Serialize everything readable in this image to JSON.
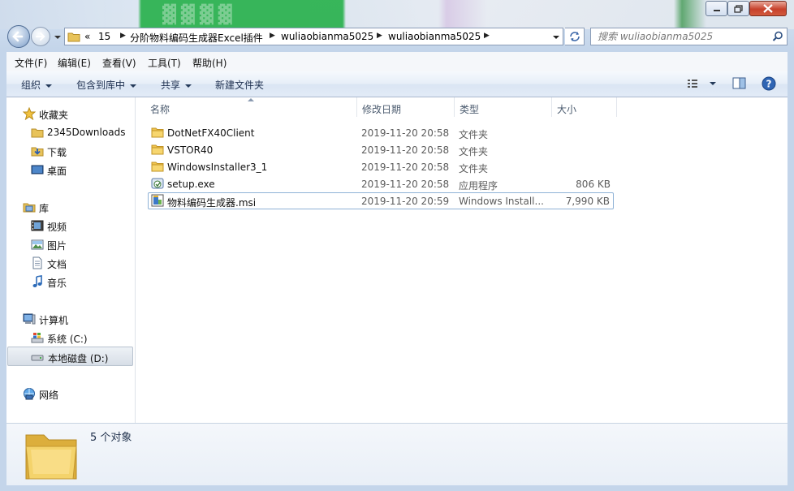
{
  "address_bar": {
    "overflow": "«",
    "crumbs": [
      "15",
      "分阶物料编码生成器Excel插件",
      "wuliaobianma5025",
      "wuliaobianma5025"
    ]
  },
  "search": {
    "placeholder": "搜索 wuliaobianma5025"
  },
  "menu": [
    "文件(F)",
    "编辑(E)",
    "查看(V)",
    "工具(T)",
    "帮助(H)"
  ],
  "commands": {
    "organize": "组织",
    "include_library": "包含到库中",
    "share": "共享",
    "new_folder": "新建文件夹"
  },
  "nav": {
    "favorites": {
      "label": "收藏夹",
      "items": [
        "2345Downloads",
        "下载",
        "桌面"
      ]
    },
    "library": {
      "label": "库",
      "items": [
        "视频",
        "图片",
        "文档",
        "音乐"
      ]
    },
    "computer": {
      "label": "计算机",
      "items": [
        "系统 (C:)",
        "本地磁盘 (D:)"
      ]
    },
    "network": {
      "label": "网络"
    }
  },
  "columns": {
    "name": "名称",
    "date": "修改日期",
    "type": "类型",
    "size": "大小"
  },
  "files": [
    {
      "name": "DotNetFX40Client",
      "date": "2019-11-20 20:58",
      "type": "文件夹",
      "size": "",
      "icon": "folder-icon"
    },
    {
      "name": "VSTOR40",
      "date": "2019-11-20 20:58",
      "type": "文件夹",
      "size": "",
      "icon": "folder-icon"
    },
    {
      "name": "WindowsInstaller3_1",
      "date": "2019-11-20 20:58",
      "type": "文件夹",
      "size": "",
      "icon": "folder-icon"
    },
    {
      "name": "setup.exe",
      "date": "2019-11-20 20:58",
      "type": "应用程序",
      "size": "806 KB",
      "icon": "exe-icon"
    },
    {
      "name": "物料编码生成器.msi",
      "date": "2019-11-20 20:59",
      "type": "Windows Install...",
      "size": "7,990 KB",
      "icon": "msi-icon"
    }
  ],
  "details": {
    "count": "5 个对象"
  },
  "colors": {
    "accent": "#2fb352",
    "selection_border": "#8fb2d6"
  }
}
